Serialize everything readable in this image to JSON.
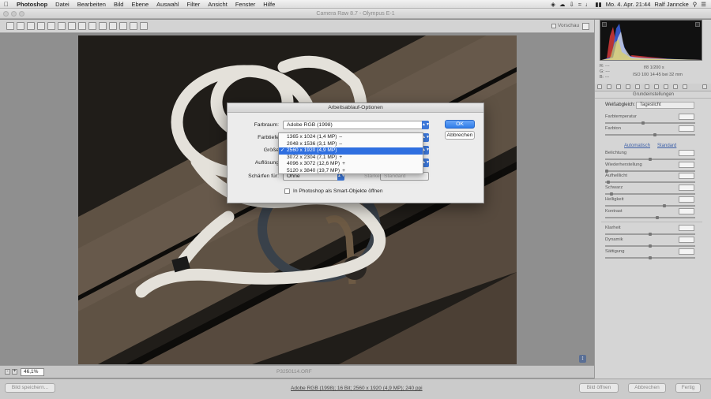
{
  "menubar": {
    "app": "Photoshop",
    "items": [
      "Datei",
      "Bearbeiten",
      "Bild",
      "Ebene",
      "Auswahl",
      "Filter",
      "Ansicht",
      "Fenster",
      "Hilfe"
    ],
    "clock": "Mo. 4. Apr. 21:44",
    "user": "Ralf Janncke"
  },
  "window": {
    "title": "Camera Raw 8.7 - Olympus E-1"
  },
  "toolbar": {
    "preview_label": "Vorschau"
  },
  "canvas": {
    "zoom": "46,1%",
    "filename": "P3250114.ORF"
  },
  "footer": {
    "save_label": "Bild speichern...",
    "workflow_link": "Adobe RGB (1998); 16 Bit; 2560 x 1920 (4,9 MP); 240 ppi",
    "open_label": "Bild öffnen",
    "cancel_label": "Abbrechen",
    "done_label": "Fertig"
  },
  "sidebar": {
    "camera_info": {
      "r": "R: ---",
      "g": "G: ---",
      "b": "B: ---",
      "aperture_shutter": "f/8   1/200 s",
      "iso_lens": "ISO 100   14-45 bei 32 mm"
    },
    "panel_title": "Grundeinstellungen",
    "white_balance_label": "Weißabgleich:",
    "white_balance_value": "Tageslicht",
    "auto_label": "Automatisch",
    "default_label": "Standard",
    "sliders": [
      {
        "label": "Farbtemperatur",
        "value": "",
        "level": 0.42
      },
      {
        "label": "Farbton",
        "value": "",
        "level": 0.55
      },
      {
        "label": "Belichtung",
        "value": "",
        "level": 0.5
      },
      {
        "label": "Wiederherstellung",
        "value": "",
        "level": 0.0
      },
      {
        "label": "Aufhelllicht",
        "value": "",
        "level": 0.02
      },
      {
        "label": "Schwarz",
        "value": "",
        "level": 0.05
      },
      {
        "label": "Helligkeit",
        "value": "",
        "level": 0.66
      },
      {
        "label": "Kontrast",
        "value": "",
        "level": 0.58
      },
      {
        "label": "Klarheit",
        "value": "",
        "level": 0.5
      },
      {
        "label": "Dynamik",
        "value": "",
        "level": 0.5
      },
      {
        "label": "Sättigung",
        "value": "",
        "level": 0.5
      }
    ]
  },
  "dialog": {
    "title": "Arbeitsablauf-Optionen",
    "colorspace_label": "Farbraum:",
    "colorspace_value": "Adobe RGB (1998)",
    "depth_label": "Farbtiefe",
    "size_label": "Größe",
    "resolution_label": "Auflösung",
    "sharpen_label": "Schärfen für:",
    "sharpen_value": "Ohne",
    "amount_label": "Stärke:",
    "amount_value": "Standard",
    "smart_objects_label": "In Photoshop als Smart-Objekte öffnen",
    "ok_label": "OK",
    "cancel_label": "Abbrechen",
    "size_options": [
      {
        "label": "1365 x 1024 (1,4 MP)",
        "mark": "–",
        "selected": false
      },
      {
        "label": "2048 x 1536 (3,1 MP)",
        "mark": "–",
        "selected": false
      },
      {
        "label": "2560 x 1920 (4,9 MP)",
        "mark": "",
        "selected": true
      },
      {
        "label": "3072 x 2304 (7,1 MP)",
        "mark": "+",
        "selected": false
      },
      {
        "label": "4096 x 3072 (12,6 MP)",
        "mark": "+",
        "selected": false
      },
      {
        "label": "5120 x 3840 (19,7 MP)",
        "mark": "+",
        "selected": false
      }
    ]
  }
}
